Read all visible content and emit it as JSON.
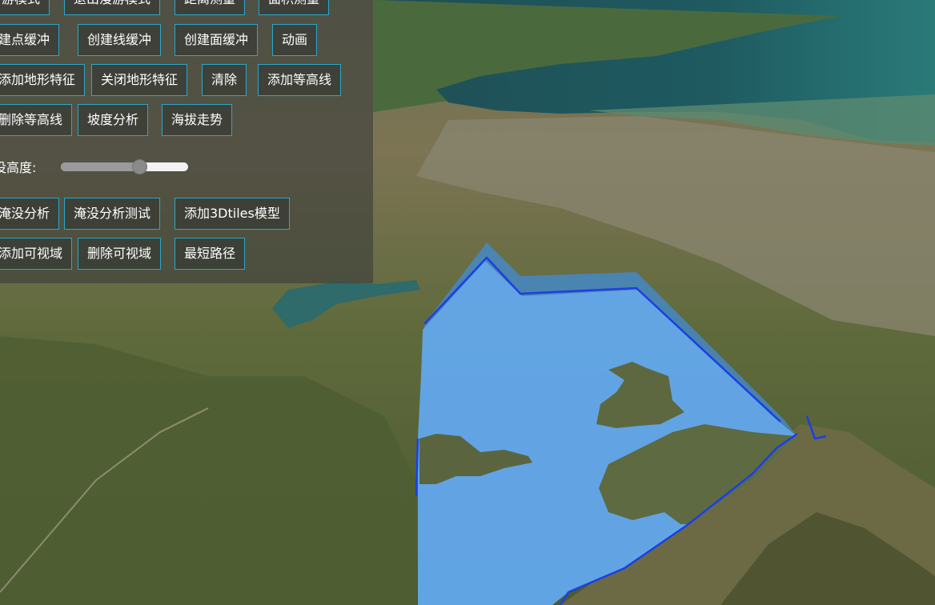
{
  "toolbar": {
    "buttons": [
      "游模式",
      "退出漫游模式",
      "距离测量",
      "面积测量",
      "建点缓冲",
      "创建线缓冲",
      "创建面缓冲",
      "动画",
      "添加地形特征",
      "关闭地形特征",
      "清除",
      "添加等高线",
      "删除等高线",
      "坡度分析",
      "海拔走势",
      "淹没分析",
      "淹没分析测试",
      "添加3Dtiles模型",
      "添加可视域",
      "删除可视域",
      "最短路径"
    ],
    "slider": {
      "label": "没高度:",
      "value_fraction": 0.62
    }
  },
  "colors": {
    "button_border": "#2aa7c9",
    "flood_fill": "#4a9ef0",
    "flood_outline": "#1550e8",
    "panel_bg": "rgba(60,62,60,0.62)"
  }
}
